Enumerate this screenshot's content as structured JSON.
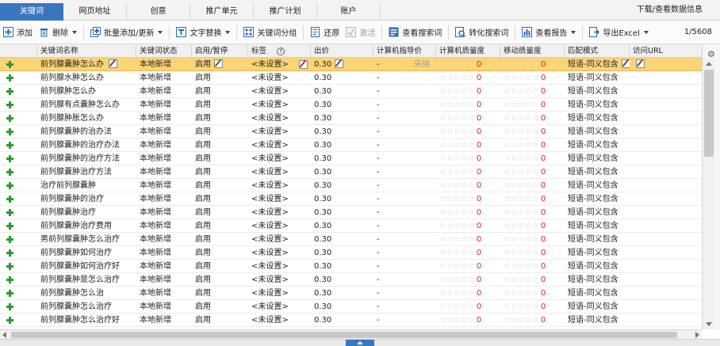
{
  "tabs": [
    {
      "label": "关键词",
      "active": true
    },
    {
      "label": "网页地址",
      "active": false
    },
    {
      "label": "创意",
      "active": false
    },
    {
      "label": "推广单元",
      "active": false
    },
    {
      "label": "推广计划",
      "active": false
    },
    {
      "label": "账户",
      "active": false
    }
  ],
  "top_right_label": "下载/查看数据信息",
  "toolbar": {
    "add": "添加",
    "delete": "删除",
    "batch_add": "批量添加/更新",
    "text_replace": "文字替换",
    "keyword_group": "关键词分组",
    "restore": "还原",
    "activate": "激活",
    "view_search_terms": "查看搜索词",
    "convert_search_terms": "转化搜索词",
    "view_report": "查看报告",
    "export": "导出Excel",
    "count": "1/5608"
  },
  "columns": [
    "关键词名称",
    "关键词状态",
    "启用/暂停",
    "标签",
    "出价",
    "计算机指导价",
    "计算机质量度",
    "移动质量度",
    "匹配模式",
    "访问URL"
  ],
  "selected_row_hint": "采纳",
  "rows": [
    {
      "name": "前列腺囊肿怎么办",
      "status": "本地新增",
      "enabled": "启用",
      "tag": "<未设置>",
      "bid": "0.30",
      "guide": "-",
      "pc_q": "0",
      "m_q": "0",
      "match": "短语-同义包含"
    },
    {
      "name": "前列腺水肿怎么办",
      "status": "本地新增",
      "enabled": "启用",
      "tag": "<未设置>",
      "bid": "0.30",
      "guide": "-",
      "pc_q": "0",
      "m_q": "0",
      "match": "短语-同义包含"
    },
    {
      "name": "前列腺肿怎么办",
      "status": "本地新增",
      "enabled": "启用",
      "tag": "<未设置>",
      "bid": "0.30",
      "guide": "-",
      "pc_q": "0",
      "m_q": "0",
      "match": "短语-同义包含"
    },
    {
      "name": "前列腺有点囊肿怎么办",
      "status": "本地新增",
      "enabled": "启用",
      "tag": "<未设置>",
      "bid": "0.30",
      "guide": "-",
      "pc_q": "0",
      "m_q": "0",
      "match": "短语-同义包含"
    },
    {
      "name": "前列腺肿胀怎么办",
      "status": "本地新增",
      "enabled": "启用",
      "tag": "<未设置>",
      "bid": "0.30",
      "guide": "-",
      "pc_q": "0",
      "m_q": "0",
      "match": "短语-同义包含"
    },
    {
      "name": "前列腺囊肿的治办法",
      "status": "本地新增",
      "enabled": "启用",
      "tag": "<未设置>",
      "bid": "0.30",
      "guide": "-",
      "pc_q": "0",
      "m_q": "0",
      "match": "短语-同义包含"
    },
    {
      "name": "前列腺囊肿的治疗办法",
      "status": "本地新增",
      "enabled": "启用",
      "tag": "<未设置>",
      "bid": "0.30",
      "guide": "-",
      "pc_q": "0",
      "m_q": "0",
      "match": "短语-同义包含"
    },
    {
      "name": "前列腺囊肿的治疗方法",
      "status": "本地新增",
      "enabled": "启用",
      "tag": "<未设置>",
      "bid": "0.30",
      "guide": "-",
      "pc_q": "0",
      "m_q": "0",
      "match": "短语-同义包含"
    },
    {
      "name": "前列腺囊肿治疗方法",
      "status": "本地新增",
      "enabled": "启用",
      "tag": "<未设置>",
      "bid": "0.30",
      "guide": "-",
      "pc_q": "0",
      "m_q": "0",
      "match": "短语-同义包含"
    },
    {
      "name": "治疗前列腺囊肿",
      "status": "本地新增",
      "enabled": "启用",
      "tag": "<未设置>",
      "bid": "0.30",
      "guide": "-",
      "pc_q": "0",
      "m_q": "0",
      "match": "短语-同义包含"
    },
    {
      "name": "前列腺囊肿的治疗",
      "status": "本地新增",
      "enabled": "启用",
      "tag": "<未设置>",
      "bid": "0.30",
      "guide": "-",
      "pc_q": "0",
      "m_q": "0",
      "match": "短语-同义包含"
    },
    {
      "name": "前列腺囊肿治疗",
      "status": "本地新增",
      "enabled": "启用",
      "tag": "<未设置>",
      "bid": "0.30",
      "guide": "-",
      "pc_q": "0",
      "m_q": "0",
      "match": "短语-同义包含"
    },
    {
      "name": "前列腺囊肿治疗费用",
      "status": "本地新增",
      "enabled": "启用",
      "tag": "<未设置>",
      "bid": "0.30",
      "guide": "-",
      "pc_q": "0",
      "m_q": "0",
      "match": "短语-同义包含"
    },
    {
      "name": "男前列腺囊肿怎么治疗",
      "status": "本地新增",
      "enabled": "启用",
      "tag": "<未设置>",
      "bid": "0.30",
      "guide": "-",
      "pc_q": "0",
      "m_q": "0",
      "match": "短语-同义包含"
    },
    {
      "name": "前列腺囊肿如何治疗",
      "status": "本地新增",
      "enabled": "启用",
      "tag": "<未设置>",
      "bid": "0.30",
      "guide": "-",
      "pc_q": "0",
      "m_q": "0",
      "match": "短语-同义包含"
    },
    {
      "name": "前列腺囊肿如何治疗好",
      "status": "本地新增",
      "enabled": "启用",
      "tag": "<未设置>",
      "bid": "0.30",
      "guide": "-",
      "pc_q": "0",
      "m_q": "0",
      "match": "短语-同义包含"
    },
    {
      "name": "前列腺囊肿是怎么治疗",
      "status": "本地新增",
      "enabled": "启用",
      "tag": "<未设置>",
      "bid": "0.30",
      "guide": "-",
      "pc_q": "0",
      "m_q": "0",
      "match": "短语-同义包含"
    },
    {
      "name": "前列腺囊肿怎么治",
      "status": "本地新增",
      "enabled": "启用",
      "tag": "<未设置>",
      "bid": "0.30",
      "guide": "-",
      "pc_q": "0",
      "m_q": "0",
      "match": "短语-同义包含"
    },
    {
      "name": "前列腺囊肿怎么治疗",
      "status": "本地新增",
      "enabled": "启用",
      "tag": "<未设置>",
      "bid": "0.30",
      "guide": "-",
      "pc_q": "0",
      "m_q": "0",
      "match": "短语-同义包含"
    },
    {
      "name": "前列腺囊肿怎么治疗好",
      "status": "本地新增",
      "enabled": "启用",
      "tag": "<未设置>",
      "bid": "0.30",
      "guide": "-",
      "pc_q": "0",
      "m_q": "0",
      "match": "短语-同义包含"
    }
  ],
  "colors": {
    "accent": "#3a75bf",
    "selected_row": "#fbd477",
    "plus_icon": "#2e9a2e",
    "zero": "#e02020"
  }
}
